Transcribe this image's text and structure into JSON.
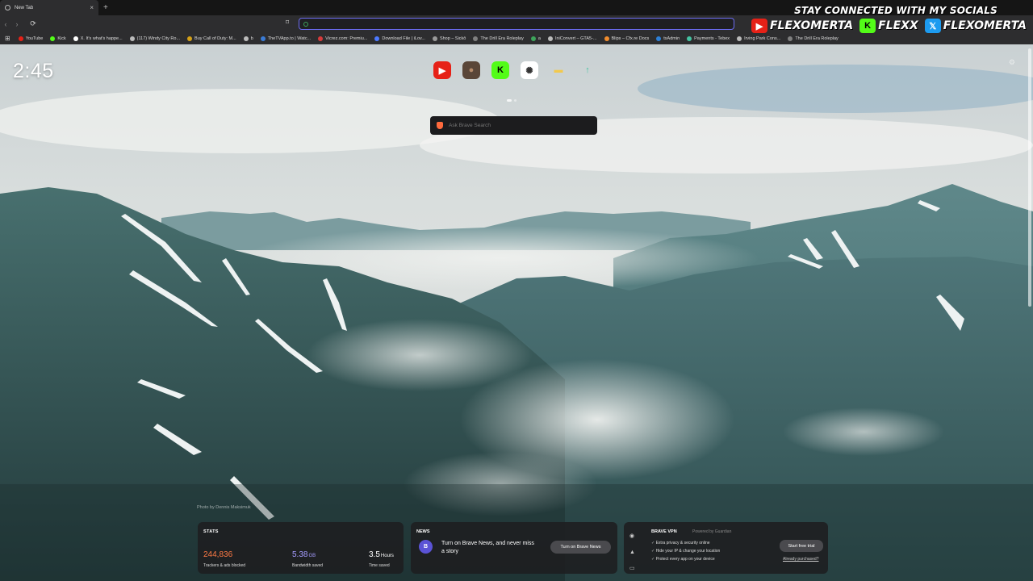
{
  "tab": {
    "title": "New Tab",
    "close": "×",
    "new": "+"
  },
  "toolbar": {
    "back": "‹",
    "forward": "›",
    "reload": "⟳",
    "bookmark": "⌑",
    "url_value": ""
  },
  "bookmarks": {
    "apps_icon": "grid-icon",
    "items": [
      {
        "label": "YouTube",
        "color": "#e62117"
      },
      {
        "label": "Kick",
        "color": "#53fc18"
      },
      {
        "label": "X. It's what's happe...",
        "color": "#ffffff"
      },
      {
        "label": "(117) Windy City Ro...",
        "color": "#bbbbbb"
      },
      {
        "label": "Buy Call of Duty: M...",
        "color": "#d4a017"
      },
      {
        "label": "b",
        "color": "#bbbbbb"
      },
      {
        "label": "TheTVApp.to | Watc...",
        "color": "#3a7bd5"
      },
      {
        "label": "Vicrez.com: Premiu...",
        "color": "#d63b3b"
      },
      {
        "label": "Download File | iLov...",
        "color": "#4c79ff"
      },
      {
        "label": "Shop – Sickō",
        "color": "#999999"
      },
      {
        "label": "The Drill Era Roleplay",
        "color": "#7f7f7f"
      },
      {
        "label": "a",
        "color": "#3da35a"
      },
      {
        "label": "IniConvert – GTA5-...",
        "color": "#bbbbbb"
      },
      {
        "label": "Blips – Cfx.re Docs",
        "color": "#f08c2e"
      },
      {
        "label": "txAdmin",
        "color": "#2d7fd6"
      },
      {
        "label": "Payments - Tebex",
        "color": "#44c3a1"
      },
      {
        "label": "Irving Park Cons...",
        "color": "#bbbbbb"
      },
      {
        "label": "The Drill Era Roleplay",
        "color": "#7f7f7f"
      }
    ]
  },
  "socials": {
    "heading": "STAY CONNECTED WITH MY SOCIALS",
    "accounts": [
      {
        "icon": "youtube-icon",
        "name": "FLEXOMERTA",
        "color": "#e62117",
        "glyph": "▶"
      },
      {
        "icon": "kick-icon",
        "name": "FLEXX",
        "color": "#53fc18",
        "glyph": "K"
      },
      {
        "icon": "x-twitter-icon",
        "name": "FLEXOMERTA",
        "color": "#1d9bf0",
        "glyph": "𝕏"
      }
    ]
  },
  "clock": "2:45",
  "top_sites": [
    {
      "icon": "youtube-icon",
      "bg": "#e62117",
      "glyph": "▶",
      "fg": "#ffffff"
    },
    {
      "icon": "avatar-icon",
      "bg": "#5a4638",
      "glyph": "●",
      "fg": "#b48a6a"
    },
    {
      "icon": "kick-icon",
      "bg": "#53fc18",
      "glyph": "K",
      "fg": "#000000"
    },
    {
      "icon": "openai-icon",
      "bg": "#ffffff",
      "glyph": "✺",
      "fg": "#333333"
    },
    {
      "icon": "folder-icon",
      "bg": "transparent",
      "glyph": "▬",
      "fg": "#f2c94c"
    },
    {
      "icon": "arrow-up-icon",
      "bg": "transparent",
      "glyph": "↑",
      "fg": "#44c3a1"
    }
  ],
  "search": {
    "placeholder": "Ask Brave Search"
  },
  "photo_credit": "Photo by Dennis Maksimuk",
  "stats": {
    "title": "STATS",
    "trackers": {
      "value": "244,836",
      "label": "Trackers & ads blocked",
      "color": "#ff7a45"
    },
    "bandwidth": {
      "value": "5.38",
      "unit": "GB",
      "label": "Bandwidth saved",
      "color": "#a59cff"
    },
    "time": {
      "value": "3.5",
      "unit": "Hours",
      "label": "Time saved",
      "color": "#ffffff"
    }
  },
  "news": {
    "title": "NEWS",
    "badge": "B",
    "message": "Turn on Brave News, and never miss a story",
    "button": "Turn on Brave News"
  },
  "vpn": {
    "title": "BRAVE VPN",
    "powered": "Powered by Guardian",
    "features": [
      "Extra privacy & security online",
      "Hide your IP & change your location",
      "Protect every app on your device"
    ],
    "button": "Start free trial",
    "link": "Already purchased?"
  }
}
